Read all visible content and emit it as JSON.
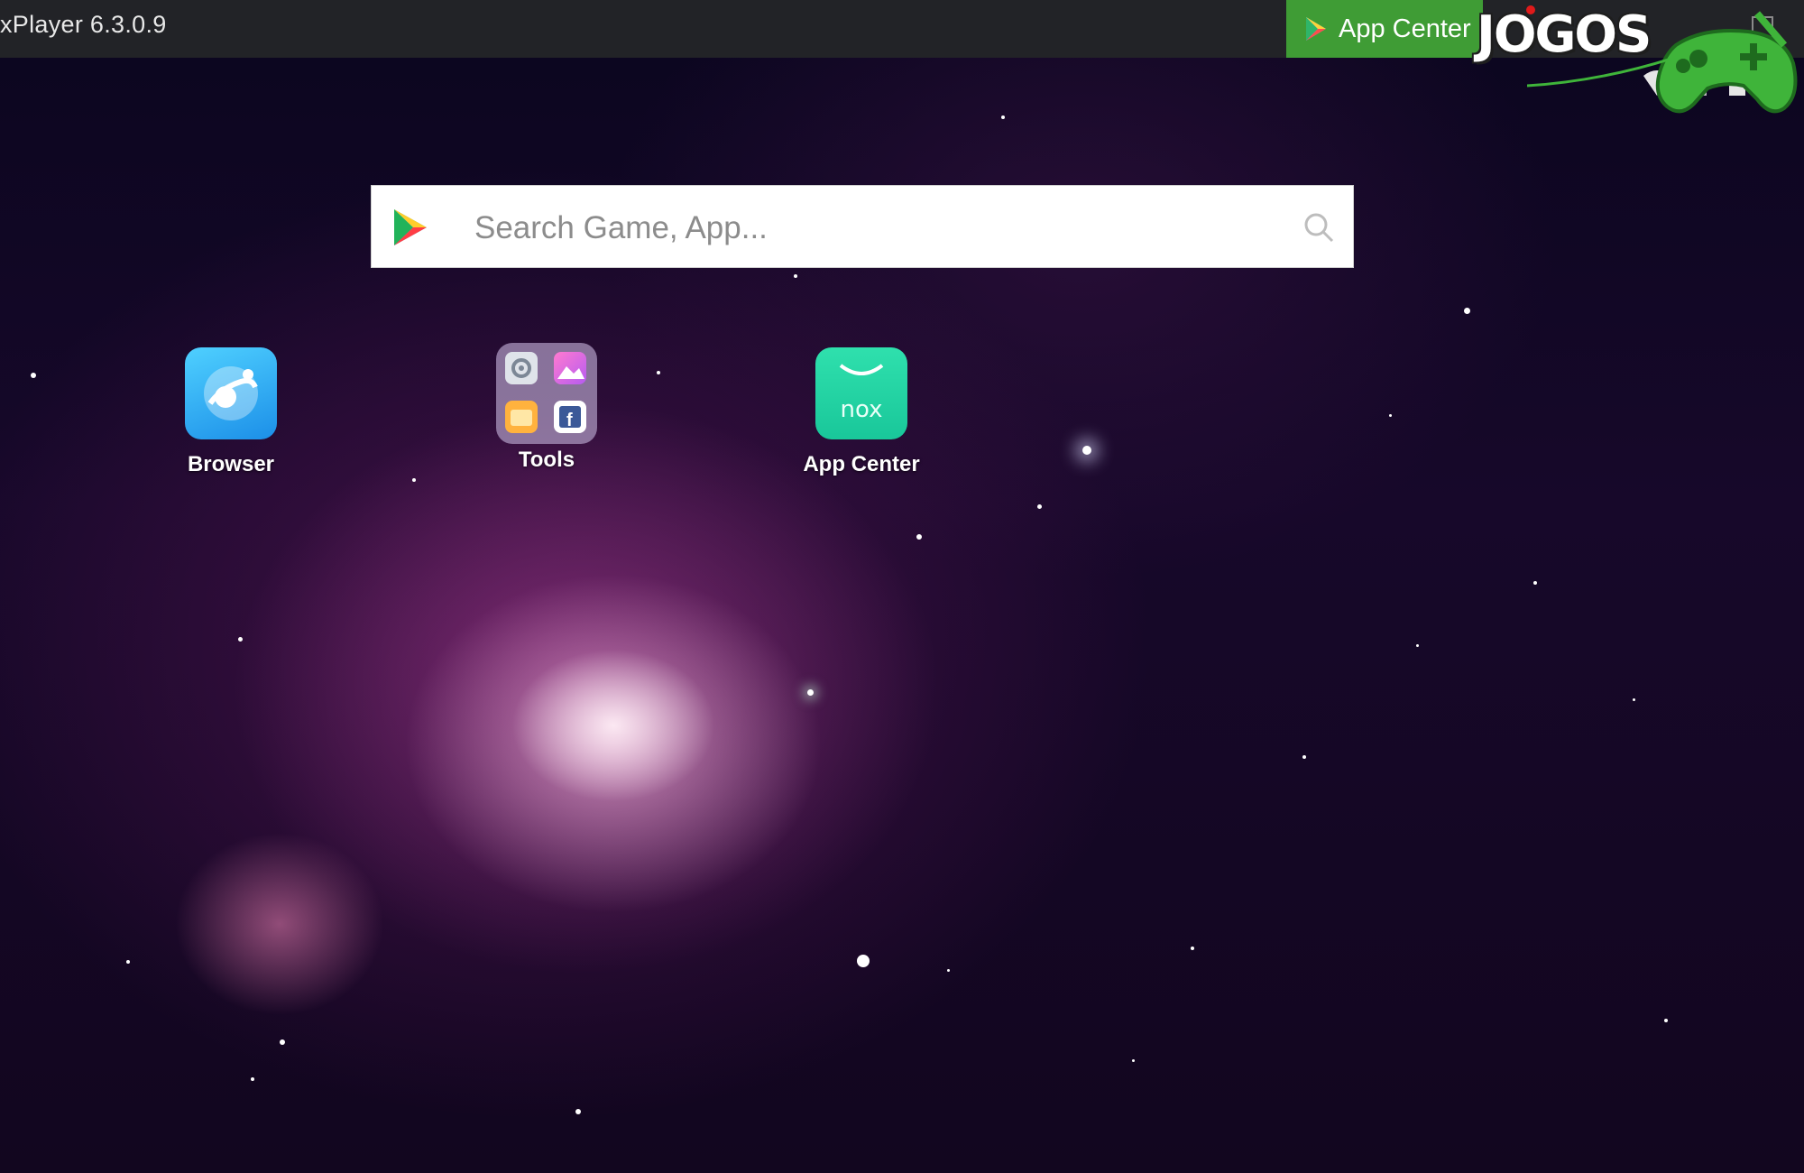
{
  "window": {
    "title": "xPlayer 6.3.0.9",
    "app_center_button": "App Center"
  },
  "watermark": {
    "text": "JOGOS"
  },
  "search": {
    "placeholder": "Search Game, App..."
  },
  "apps": [
    {
      "label": "Browser",
      "icon": "browser-icon"
    },
    {
      "label": "Tools",
      "icon": "tools-folder-icon"
    },
    {
      "label": "App Center",
      "icon": "nox-app-center-icon",
      "icon_text": "nox"
    }
  ],
  "colors": {
    "titlebar": "#222327",
    "app_center_button": "#3f9c35",
    "nox_green": "#1fd3a3",
    "browser_blue": "#1c8fe8"
  }
}
